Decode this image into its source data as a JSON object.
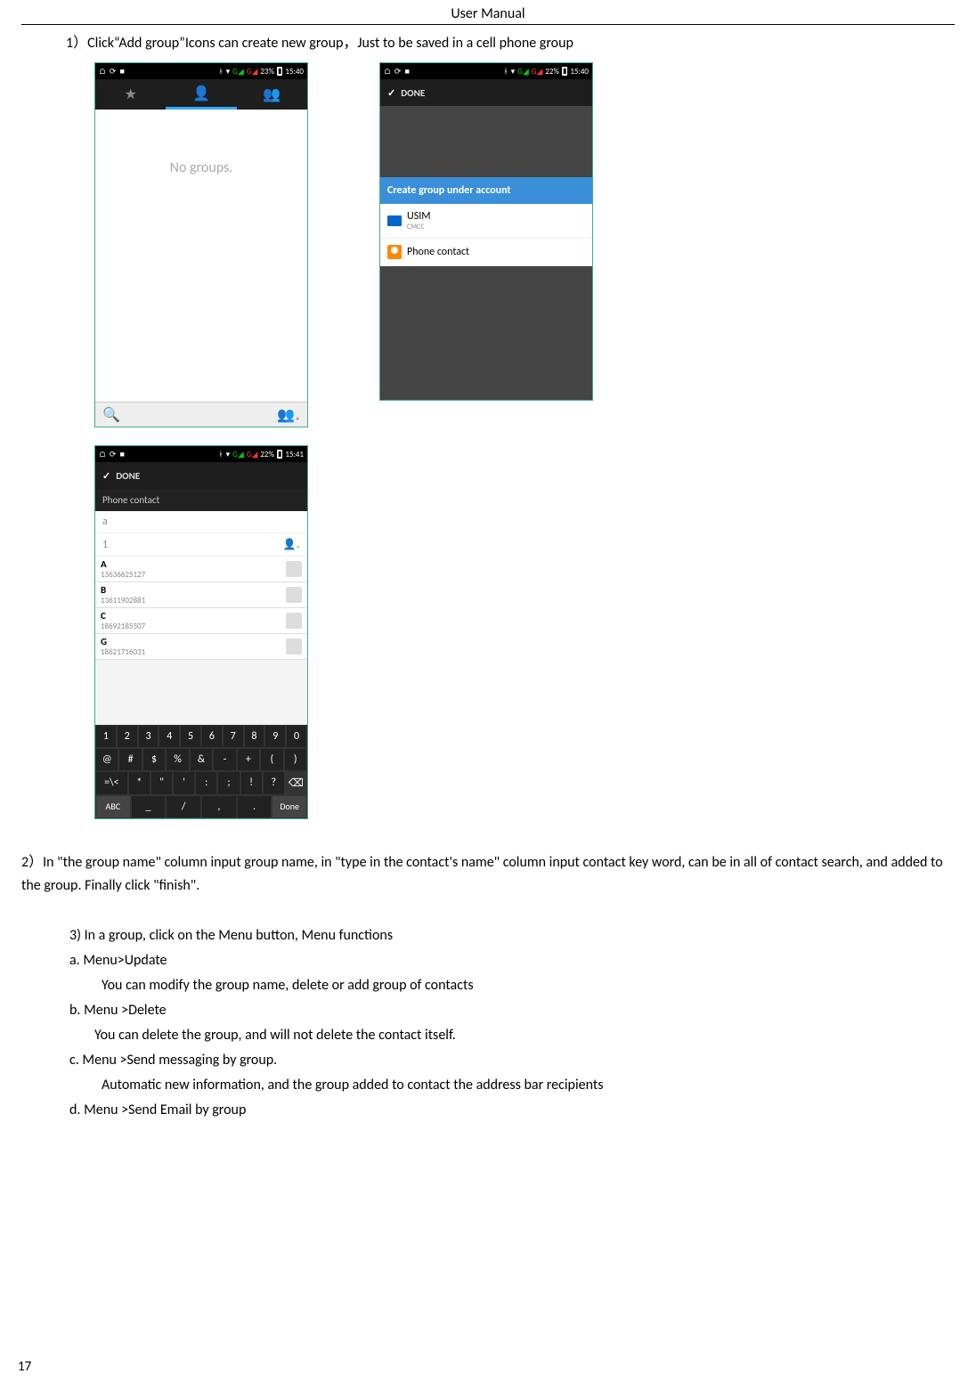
{
  "header": "User    Manual",
  "page_number": "17",
  "step1": "1）Click“Add group”Icons can create new group，Just to be saved in a cell phone group",
  "step2": "2）In \"the group name\" column input group name, in \"type in the contact's name\" column input contact key word, can be in all of contact search, and added to the group. Finally click \"finish\".",
  "step3_intro": " 3) In a group, click on the Menu button,    Menu functions",
  "menu_a_title": "a.    Menu>Update",
  "menu_a_desc": "You can modify the group name, delete or add group of contacts",
  "menu_b_title": "b.    Menu >Delete",
  "menu_b_desc": "You can delete the group, and will not delete the contact itself.",
  "menu_c_title": " c.    Menu >Send messaging by group.",
  "menu_c_desc": "Automatic new information, and the group added to contact the address bar recipients",
  "menu_d_title": "d.    Menu >Send Email by group",
  "shot1": {
    "status_time": "15:40",
    "status_batt": "23%",
    "no_groups": "No groups."
  },
  "shot2": {
    "status_time": "15:40",
    "status_batt": "22%",
    "done": "DONE",
    "modal_title": "Create group under account",
    "usim": "USIM",
    "cmcc": "CMCC",
    "phone_contact": "Phone contact"
  },
  "shot3": {
    "status_time": "15:41",
    "status_batt": "22%",
    "done": "DONE",
    "header": "Phone contact",
    "field_a": "a",
    "field_1": "1",
    "contacts": [
      {
        "letter": "A",
        "num": "13636625127"
      },
      {
        "letter": "B",
        "num": "13611902881"
      },
      {
        "letter": "C",
        "num": "18692185507"
      },
      {
        "letter": "G",
        "num": "18621716031"
      }
    ],
    "kb": {
      "r1": [
        "1",
        "2",
        "3",
        "4",
        "5",
        "6",
        "7",
        "8",
        "9",
        "0"
      ],
      "r2": [
        "@",
        "#",
        "$",
        "%",
        "&",
        "-",
        "+",
        "(",
        ")"
      ],
      "r3": [
        "=\\<",
        "*",
        "\"",
        "'",
        ":",
        ";",
        "!",
        "?",
        "⌫"
      ],
      "r4": [
        "ABC",
        "_",
        "/",
        ",",
        ".",
        "Done"
      ]
    }
  }
}
